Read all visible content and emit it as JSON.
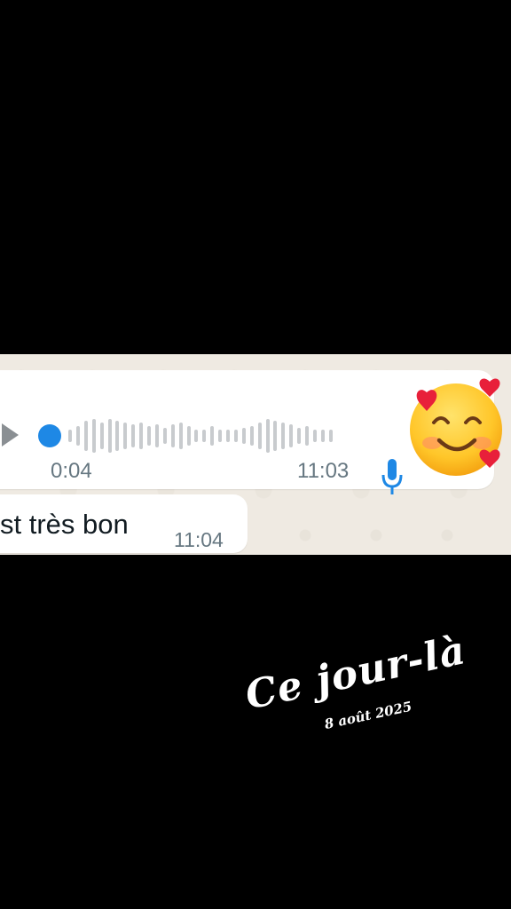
{
  "voice_message": {
    "duration": "0:04",
    "time": "11:03",
    "progress": 0
  },
  "text_message": {
    "text": "st très bon",
    "time": "11:04"
  },
  "reaction": {
    "icon": "smiling-face-with-hearts-icon"
  },
  "caption": {
    "title": "Ce jour-là",
    "date": "8 août 2025"
  },
  "colors": {
    "seek_dot": "#1e88e5",
    "mic": "#1e88e5",
    "background": "#000000",
    "chat_wallpaper": "#efeae2"
  }
}
